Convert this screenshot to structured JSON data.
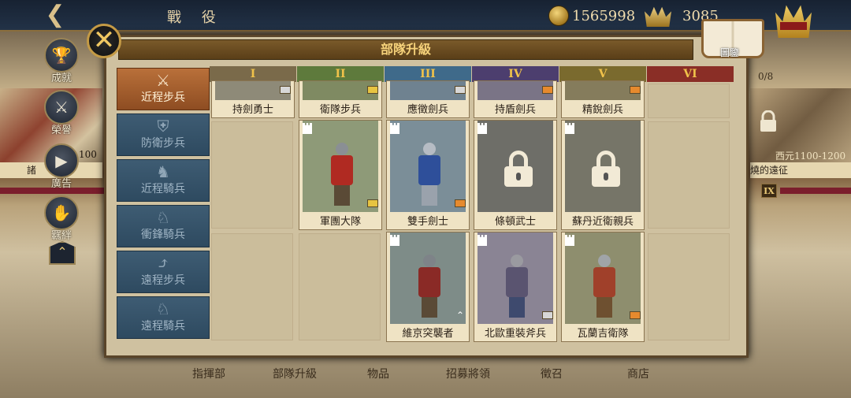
{
  "top": {
    "title": "戰 役",
    "gold": "1565998",
    "crowns": "3085"
  },
  "panel": {
    "title": "部隊升級",
    "book_label": "圖鑒"
  },
  "columns": [
    "I",
    "II",
    "III",
    "IV",
    "V",
    "VI"
  ],
  "column_colors": [
    "#7a6a4a",
    "#5e7a3c",
    "#3f6a8a",
    "#4c3e6e",
    "#7a6a2e",
    "#8a2e26"
  ],
  "categories": [
    {
      "label": "近程步兵",
      "icon": "crossed-swords-icon",
      "active": true
    },
    {
      "label": "防衛步兵",
      "icon": "shield-icon",
      "active": false
    },
    {
      "label": "近程騎兵",
      "icon": "horse-head-icon",
      "active": false
    },
    {
      "label": "衝鋒騎兵",
      "icon": "lance-horse-icon",
      "active": false
    },
    {
      "label": "遠程步兵",
      "icon": "bow-icon",
      "active": false
    },
    {
      "label": "遠程騎兵",
      "icon": "horse-archer-icon",
      "active": false
    }
  ],
  "row1": [
    {
      "name": "持劍勇士",
      "rank": "silver"
    },
    {
      "name": "衛隊步兵",
      "rank": "gold"
    },
    {
      "name": "應徵劍兵",
      "rank": "silver"
    },
    {
      "name": "持盾劍兵",
      "rank": "orange"
    },
    {
      "name": "精銳劍兵",
      "rank": "orange"
    }
  ],
  "row2": [
    {
      "name": "軍團大隊",
      "rank": "gold",
      "locked": false,
      "tint": "#b02a22"
    },
    {
      "name": "雙手劍士",
      "rank": "orange",
      "locked": false,
      "tint": "#2e4f9a"
    },
    {
      "name": "條頓武士",
      "rank": "",
      "locked": true,
      "tint": "#7a7a72"
    },
    {
      "name": "蘇丹近衛親兵",
      "rank": "",
      "locked": true,
      "tint": "#8a8a7a"
    }
  ],
  "row3": [
    {
      "name": "維京突襲者",
      "rank": "chevron",
      "tint": "#8a2a26"
    },
    {
      "name": "北歐重裝斧兵",
      "rank": "silver",
      "tint": "#5a5470"
    },
    {
      "name": "瓦蘭吉衛隊",
      "rank": "orange",
      "tint": "#a0402a"
    }
  ],
  "side_nav": [
    {
      "label": "成就",
      "icon": "trophy-icon"
    },
    {
      "label": "榮譽",
      "icon": "sword-emblem-icon"
    },
    {
      "label": "廣告",
      "icon": "film-icon"
    },
    {
      "label": "羈絆",
      "icon": "handshake-icon"
    }
  ],
  "bottom_nav": [
    "指揮部",
    "部隊升級",
    "物品",
    "招募將領",
    "徵召",
    "商店"
  ],
  "left_card": {
    "label": "諸",
    "small": "100"
  },
  "right_card": {
    "count": "0/8",
    "era": "西元1100-1200",
    "label": "燒的遠征",
    "tier": "IX"
  }
}
